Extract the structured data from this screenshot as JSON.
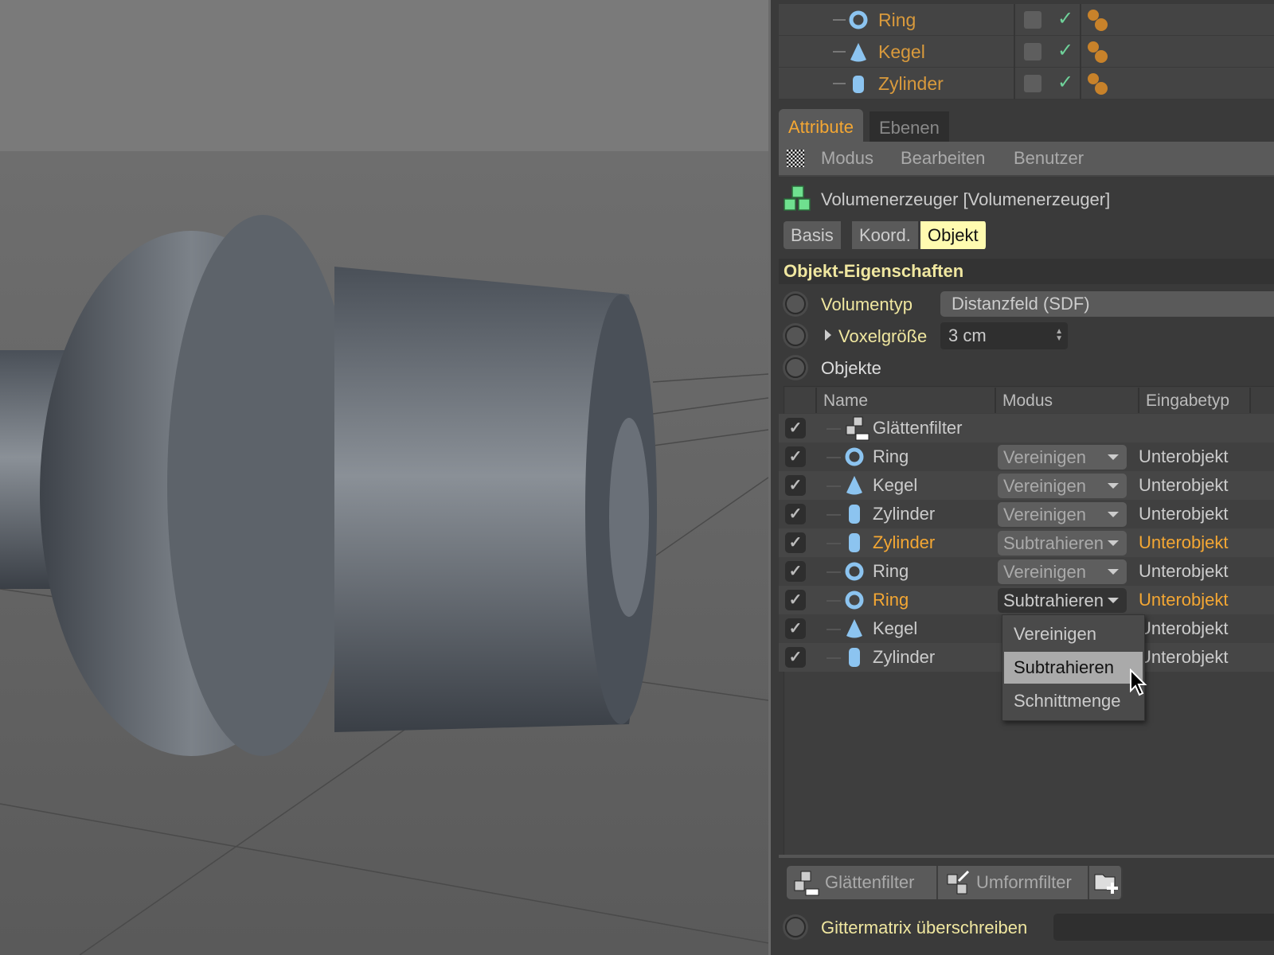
{
  "object_manager": {
    "rows": [
      {
        "label": "Ring",
        "icon": "ring-icon"
      },
      {
        "label": "Kegel",
        "icon": "cone-icon"
      },
      {
        "label": "Zylinder",
        "icon": "cylinder-icon"
      }
    ]
  },
  "tabs": {
    "attribute": "Attribute",
    "ebenen": "Ebenen"
  },
  "menu": {
    "modus": "Modus",
    "bearbeiten": "Bearbeiten",
    "benutzer": "Benutzer"
  },
  "object_title": "Volumenerzeuger [Volumenerzeuger]",
  "subtabs": {
    "basis": "Basis",
    "koord": "Koord.",
    "objekt": "Objekt"
  },
  "section_title": "Objekt-Eigenschaften",
  "props": {
    "volumentyp_label": "Volumentyp",
    "volumentyp_value": "Distanzfeld (SDF)",
    "voxel_label": "Voxelgröße",
    "voxel_value": "3 cm",
    "objekte_label": "Objekte"
  },
  "list": {
    "headers": {
      "name": "Name",
      "modus": "Modus",
      "eingabetyp": "Eingabetyp"
    },
    "rows": [
      {
        "name": "Glättenfilter",
        "icon": "smooth-filter-icon",
        "modus": "",
        "typ": "",
        "highlight": false
      },
      {
        "name": "Ring",
        "icon": "ring-icon",
        "modus": "Vereinigen",
        "typ": "Unterobjekt",
        "highlight": false
      },
      {
        "name": "Kegel",
        "icon": "cone-icon",
        "modus": "Vereinigen",
        "typ": "Unterobjekt",
        "highlight": false
      },
      {
        "name": "Zylinder",
        "icon": "cylinder-icon",
        "modus": "Vereinigen",
        "typ": "Unterobjekt",
        "highlight": false
      },
      {
        "name": "Zylinder",
        "icon": "cylinder-icon",
        "modus": "Subtrahieren",
        "typ": "Unterobjekt",
        "highlight": true
      },
      {
        "name": "Ring",
        "icon": "ring-icon",
        "modus": "Vereinigen",
        "typ": "Unterobjekt",
        "highlight": false
      },
      {
        "name": "Ring",
        "icon": "ring-icon",
        "modus": "Subtrahieren",
        "typ": "Unterobjekt",
        "highlight": true
      },
      {
        "name": "Kegel",
        "icon": "cone-icon",
        "modus": "",
        "typ": "Unterobjekt",
        "highlight": false
      },
      {
        "name": "Zylinder",
        "icon": "cylinder-icon",
        "modus": "",
        "typ": "Unterobjekt",
        "highlight": false
      }
    ]
  },
  "dropdown": {
    "options": [
      "Vereinigen",
      "Subtrahieren",
      "Schnittmenge"
    ],
    "selected": "Subtrahieren"
  },
  "buttons": {
    "glaetten": "Glättenfilter",
    "umform": "Umformfilter"
  },
  "gitter_label": "Gittermatrix überschreiben",
  "colors": {
    "accent_orange": "#f4a733",
    "prop_yellow": "#f0e7a0",
    "active_tab_bg": "#fffbb0",
    "icon_blue": "#8cc4f0"
  }
}
